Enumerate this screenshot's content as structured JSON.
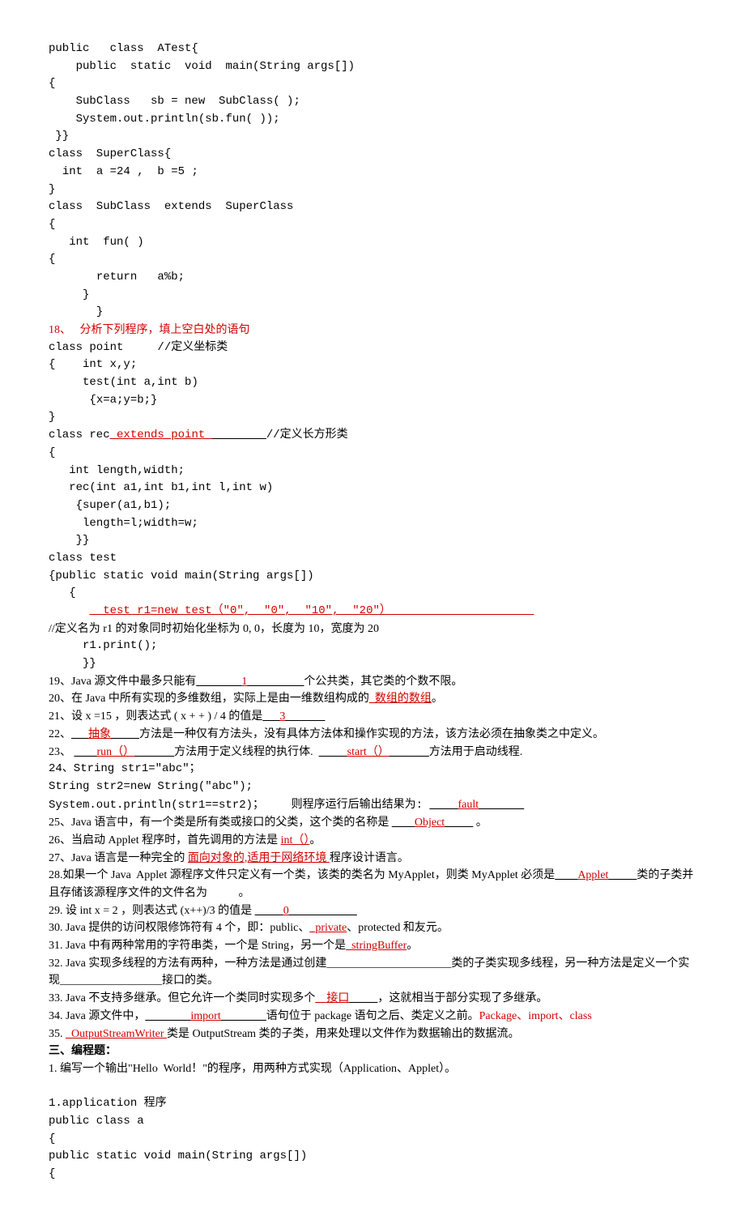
{
  "code1": [
    "public   class  ATest{",
    "    public  static  void  main(String args[])",
    "{",
    "    SubClass   sb = new  SubClass( );",
    "    System.out.println(sb.fun( ));",
    " }}",
    "class  SuperClass{",
    "  int  a =24 ,  b =5 ;",
    "}",
    "class  SubClass  extends  SuperClass",
    "{",
    "   int  fun( )",
    "{",
    "       return   a%b;",
    "     }",
    "       }"
  ],
  "q18": {
    "prefix": "18、   ",
    "title": "分析下列程序，填上空白处的语句"
  },
  "code2a": [
    "class point     //定义坐标类",
    "{    int x,y;",
    "     test(int a,int b)",
    "      {x=a;y=b;}",
    "}"
  ],
  "code2_rec": {
    "prefix": "class rec",
    "answer": "_extends point ",
    "blank": "________",
    "suffix": "//定义长方形类"
  },
  "code2b": [
    "{",
    "   int length,width;",
    "   rec(int a1,int b1,int l,int w)",
    "    {super(a1,b1);",
    "     length=l;width=w;",
    "    }}",
    "class test",
    "{public static void main(String args[])",
    "   {"
  ],
  "code2_test": {
    "indent": "      ",
    "answer": "  test r1=new test（\"0\",  \"0\",  \"10\",  \"20\"）                     "
  },
  "code2c": [
    "//定义名为 r1 的对象同时初始化坐标为 0, 0，长度为 10，宽度为 20",
    "     r1.print();",
    "     }}"
  ],
  "q19": {
    "a": "19、Java 源文件中最多只能有",
    "b": "________",
    "ans": "1",
    "c": "__________",
    "d": "个公共类，其它类的个数不限。"
  },
  "q20": {
    "a": "20、在 Java 中所有实现的多维数组，实际上是由一维数组构成的",
    "ans": "_数组的数组",
    "b": "。"
  },
  "q21": {
    "a": "21、设 x =15 ，则表达式 ( x + + ) / 4 的值是",
    "b": "___",
    "ans": "3",
    "c": "_______"
  },
  "q22": {
    "a": "22、",
    "b": "___",
    "ans": "抽象",
    "c": "_____",
    "d": "方法是一种仅有方法头，没有具体方法体和操作实现的方法，该方法必须在抽象类之中定义。"
  },
  "q23": {
    "a": "23、 ",
    "b1": "____",
    "ans1": "run（）",
    "c1": "_______",
    "d": "方法用于定义线程的执行体.  ",
    "b2": "_____",
    "ans2": "start（）",
    "c2": "_______",
    "e": "方法用于启动线程."
  },
  "q24": {
    "a": "24、String str1=\"abc\"；",
    "b": "String str2=new String(\"abc\");",
    "c": "System.out.println(str1==str2)；    则程序运行后输出结果为: ",
    "d": "_____",
    "ans": "fault",
    "e": "________"
  },
  "q25": {
    "a": "25、Java 语言中，有一个类是所有类或接口的父类，这个类的名称是 ",
    "b": "____",
    "ans": "Object",
    "c": "_____",
    "d": " 。"
  },
  "q26": {
    "a": "26、当启动 Applet 程序时，首先调用的方法是 ",
    "ans": "int（）",
    "b": "。"
  },
  "q27": {
    "a": "27、Java 语言是一种完全的 ",
    "ans": "面向对象的,适用于网络环境 ",
    "b": "程序设计语言。"
  },
  "q28": {
    "a": "28.如果一个 Java  Applet 源程序文件只定义有一个类，该类的类名为 MyApplet，则类 MyApplet 必须是",
    "b": "____",
    "ans": "Applet",
    "c": "_____",
    "d": "类的子类并且存储该源程序文件的文件名为           。"
  },
  "q29": {
    "a": "29. 设 int x = 2 ，则表达式 (x++)/3 的值是 ",
    "b": "_____",
    "ans": "0",
    "c": "____________"
  },
  "q30": {
    "a": "30. Java 提供的访问权限修饰符有 4 个，即：public、",
    "ans": "_private",
    "b": "、protected 和友元。"
  },
  "q31": {
    "a": "31. Java 中有两种常用的字符串类，一个是 String，另一个是",
    "ans": "_stringBuffer",
    "b": "。"
  },
  "q32": {
    "a": "32. Java 实现多线程的方法有两种，一种方法是通过创建______________________类的子类实现多线程，另一种方法是定义一个实现__________________接口的类。"
  },
  "q33": {
    "a": "33. Java 不支持多继承。但它允许一个类同时实现多个",
    "ans": "__接口",
    "b": "_____",
    "c": "，这就相当于部分实现了多继承。"
  },
  "q34": {
    "a": "34. Java 源文件中，",
    "b": "________",
    "ans": "import",
    "c": "________",
    "d": "语句位于 package 语句之后、类定义之前。",
    "e": "Package、import、class"
  },
  "q35": {
    "a": "35. ",
    "ans": "  OutputStreamWriter ",
    "b": "类是 OutputStream 类的子类，用来处理以文件作为数据输出的数据流。"
  },
  "section3": "三、编程题：",
  "p1": "1. 编写一个输出\"Hello  World！\"的程序，用两种方式实现（Application、Applet）。",
  "code3": [
    "",
    "1.application 程序",
    "public class a",
    "{",
    "public static void main(String args[])",
    "{"
  ]
}
